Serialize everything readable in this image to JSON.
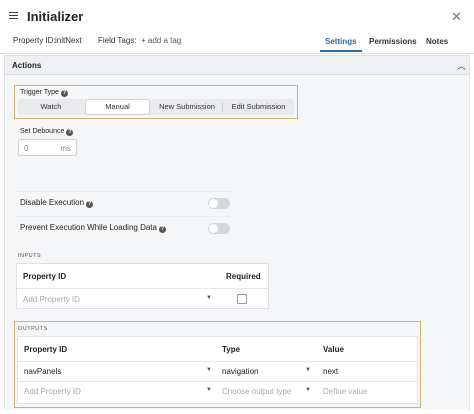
{
  "header": {
    "title": "Initializer",
    "property_id_label": "Property ID:",
    "property_id_value": "initNext",
    "field_tags_label": "Field Tags:",
    "add_tag": "+ add a tag",
    "tabs": [
      {
        "label": "Settings",
        "active": true
      },
      {
        "label": "Permissions",
        "active": false
      },
      {
        "label": "Notes",
        "active": false
      }
    ]
  },
  "actions": {
    "title": "Actions",
    "trigger_type": {
      "label": "Trigger Type",
      "options": [
        "Watch",
        "Manual",
        "New Submission",
        "Edit Submission"
      ],
      "selected": "Manual"
    },
    "debounce": {
      "label": "Set Debounce",
      "value": "0",
      "unit": "ms"
    },
    "disable_execution": {
      "label": "Disable Execution",
      "on": false
    },
    "prevent_execution": {
      "label": "Prevent Execution While Loading Data",
      "on": false
    }
  },
  "inputs": {
    "caption": "INPUTS",
    "columns": [
      "Property ID",
      "Required"
    ],
    "placeholder": "Add Property ID"
  },
  "outputs": {
    "caption": "OUTPUTS",
    "columns": [
      "Property ID",
      "Type",
      "Value"
    ],
    "rows": [
      {
        "property_id": "navPanels",
        "type": "navigation",
        "value": "next"
      }
    ],
    "new_row": {
      "property_placeholder": "Add Property ID",
      "type_placeholder": "Choose output type",
      "value_placeholder": "Define value"
    }
  },
  "colors": {
    "accent": "#2b6cb0",
    "highlight": "#c9b56a"
  }
}
